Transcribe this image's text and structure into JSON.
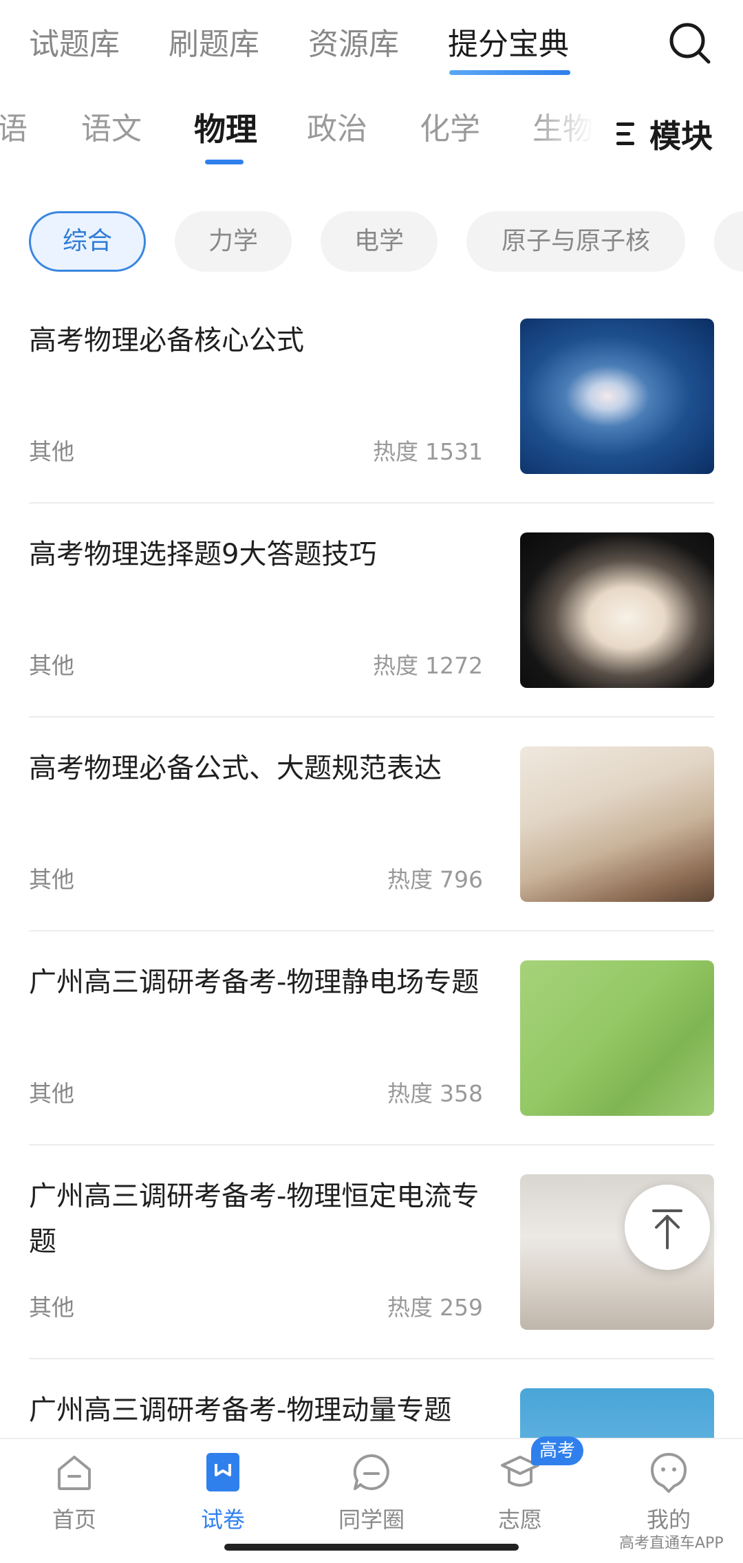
{
  "top_tabs": [
    {
      "label": "试题库"
    },
    {
      "label": "刷题库"
    },
    {
      "label": "资源库"
    },
    {
      "label": "提分宝典"
    }
  ],
  "subjects": [
    {
      "label": "语"
    },
    {
      "label": "语文"
    },
    {
      "label": "物理"
    },
    {
      "label": "政治"
    },
    {
      "label": "化学"
    },
    {
      "label": "生物"
    }
  ],
  "module_label": "模块",
  "chips": [
    {
      "label": "综合"
    },
    {
      "label": "力学"
    },
    {
      "label": "电学"
    },
    {
      "label": "原子与原子核"
    }
  ],
  "heat_label": "热度",
  "articles": [
    {
      "title": "高考物理必备核心公式",
      "category": "其他",
      "heat": "1531"
    },
    {
      "title": "高考物理选择题9大答题技巧",
      "category": "其他",
      "heat": "1272"
    },
    {
      "title": "高考物理必备公式、大题规范表达",
      "category": "其他",
      "heat": "796"
    },
    {
      "title": "广州高三调研考备考-物理静电场专题",
      "category": "其他",
      "heat": "358"
    },
    {
      "title": "广州高三调研考备考-物理恒定电流专题",
      "category": "其他",
      "heat": "259"
    },
    {
      "title": "广州高三调研考备考-物理动量专题",
      "category": "",
      "heat": ""
    }
  ],
  "bottom_nav": [
    {
      "label": "首页"
    },
    {
      "label": "试卷"
    },
    {
      "label": "同学圈"
    },
    {
      "label": "志愿"
    },
    {
      "label": "我的"
    }
  ],
  "badge": "高考",
  "watermark": "高考直通车APP",
  "colors": {
    "accent": "#2f80ed",
    "chip_active_bg": "#eaf3ff"
  }
}
